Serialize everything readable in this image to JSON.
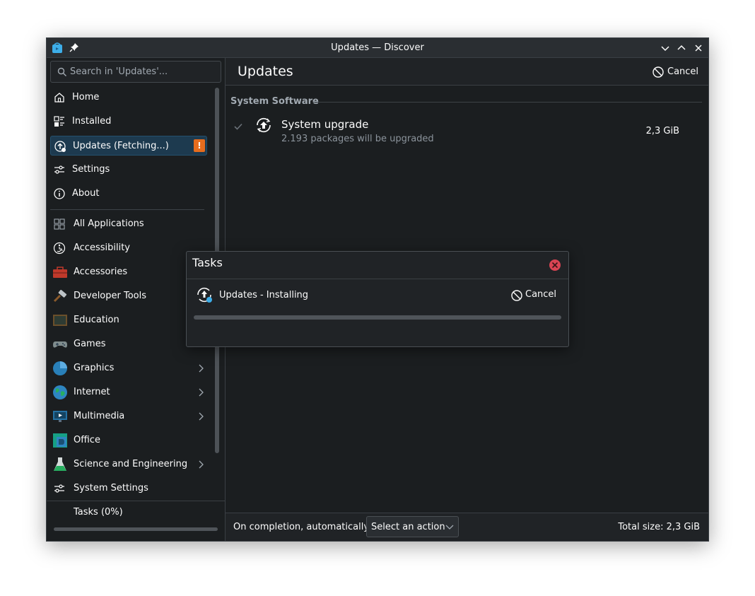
{
  "window": {
    "title": "Updates — Discover"
  },
  "search": {
    "placeholder": "Search in 'Updates'..."
  },
  "nav": {
    "items": [
      {
        "label": "Home"
      },
      {
        "label": "Installed"
      },
      {
        "label": "Updates (Fetching...)",
        "badge": "!"
      },
      {
        "label": "Settings"
      },
      {
        "label": "About"
      }
    ]
  },
  "categories": [
    {
      "label": "All Applications",
      "icon": "grid-icon"
    },
    {
      "label": "Accessibility",
      "icon": "accessibility-icon"
    },
    {
      "label": "Accessories",
      "icon": "toolbox-icon"
    },
    {
      "label": "Developer Tools",
      "icon": "hammer-icon"
    },
    {
      "label": "Education",
      "icon": "chalkboard-icon"
    },
    {
      "label": "Games",
      "icon": "gamepad-icon"
    },
    {
      "label": "Graphics",
      "icon": "graphics-icon",
      "expandable": true
    },
    {
      "label": "Internet",
      "icon": "globe-icon",
      "expandable": true
    },
    {
      "label": "Multimedia",
      "icon": "monitor-icon",
      "expandable": true
    },
    {
      "label": "Office",
      "icon": "office-icon"
    },
    {
      "label": "Science and Engineering",
      "icon": "flask-icon",
      "expandable": true
    },
    {
      "label": "System Settings",
      "icon": "sliders-icon"
    }
  ],
  "tasks_footer": {
    "label": "Tasks (0%)",
    "progress": 0
  },
  "main": {
    "title": "Updates",
    "cancel_label": "Cancel",
    "section": "System Software",
    "updates": [
      {
        "name": "System upgrade",
        "description": "2.193 packages will be upgraded",
        "size": "2,3 GiB",
        "checked": true
      }
    ],
    "footer": {
      "completion_label": "On completion, automatically:",
      "action_select": "Select an action",
      "total_size": "Total size: 2,3 GiB"
    }
  },
  "dialog": {
    "title": "Tasks",
    "task_name": "Updates - Installing",
    "cancel_label": "Cancel",
    "progress": 0
  },
  "colors": {
    "accent": "#3daee9",
    "warning_badge": "#e66c1d",
    "close_red": "#da4453",
    "window_bg": "#1b1e20"
  }
}
